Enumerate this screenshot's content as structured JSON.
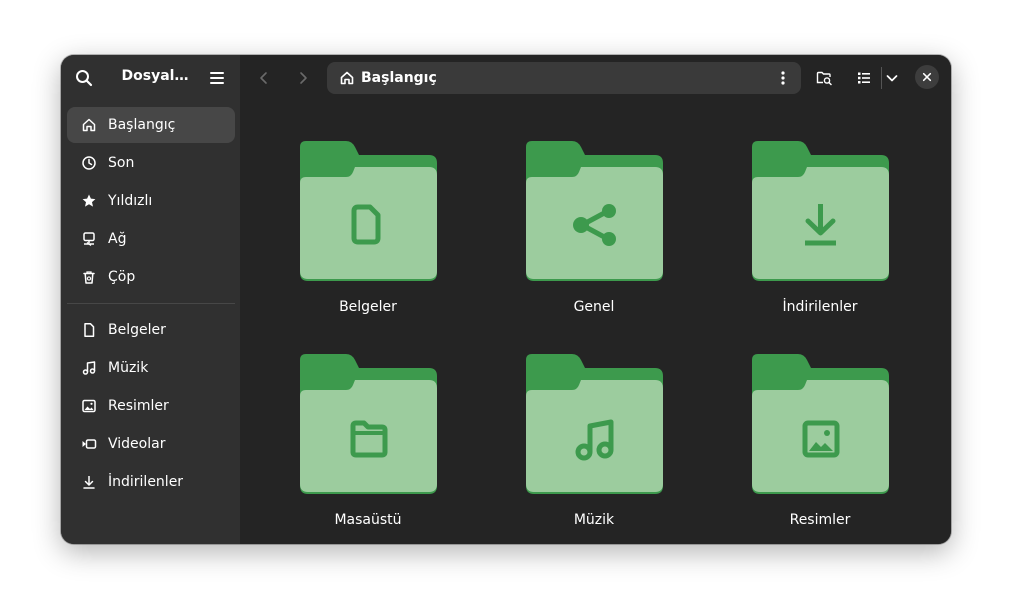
{
  "sidebar": {
    "title": "Dosyal…",
    "places": [
      {
        "label": "Başlangıç",
        "icon": "home-icon",
        "active": true
      },
      {
        "label": "Son",
        "icon": "clock-icon"
      },
      {
        "label": "Yıldızlı",
        "icon": "star-icon"
      },
      {
        "label": "Ağ",
        "icon": "network-icon"
      },
      {
        "label": "Çöp",
        "icon": "trash-icon"
      }
    ],
    "bookmarks": [
      {
        "label": "Belgeler",
        "icon": "document-icon"
      },
      {
        "label": "Müzik",
        "icon": "music-icon"
      },
      {
        "label": "Resimler",
        "icon": "image-icon"
      },
      {
        "label": "Videolar",
        "icon": "video-icon"
      },
      {
        "label": "İndirilenler",
        "icon": "download-icon"
      }
    ]
  },
  "header": {
    "path_label": "Başlangıç"
  },
  "folders": [
    {
      "label": "Belgeler",
      "emblem": "document-icon"
    },
    {
      "label": "Genel",
      "emblem": "share-icon"
    },
    {
      "label": "İndirilenler",
      "emblem": "download-icon"
    },
    {
      "label": "Masaüstü",
      "emblem": "folder-icon"
    },
    {
      "label": "Müzik",
      "emblem": "music-icon"
    },
    {
      "label": "Resimler",
      "emblem": "image-icon"
    }
  ],
  "colors": {
    "window_bg": "#242424",
    "sidebar_bg": "#303030",
    "folder_back": "#3d9a4d",
    "folder_front": "#9ccc9e",
    "folder_emblem": "#3d9a4d"
  }
}
